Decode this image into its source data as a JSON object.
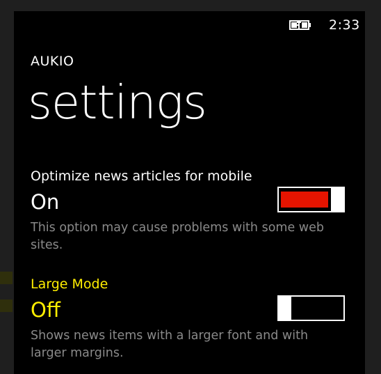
{
  "status_bar": {
    "battery_icon": "battery-charging-icon",
    "time": "2:33"
  },
  "app": {
    "name": "AUKIO",
    "page_title": "settings"
  },
  "settings": [
    {
      "label": "Optimize news articles for mobile",
      "state": "On",
      "on": true,
      "description": "This option may cause problems with some web sites."
    },
    {
      "label": "Large Mode",
      "state": "Off",
      "on": false,
      "description": "Shows news items with a larger font and with larger margins."
    }
  ],
  "colors": {
    "accent_red": "#e51400",
    "highlight_yellow": "#ffee00",
    "desc_gray": "#8a8a8a"
  }
}
